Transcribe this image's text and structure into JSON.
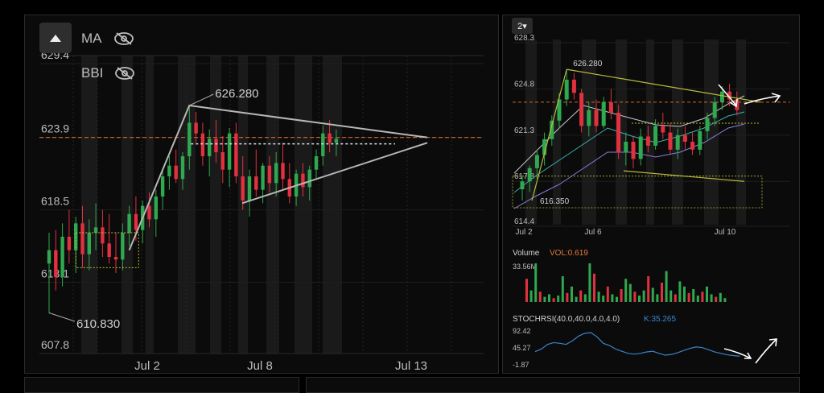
{
  "main": {
    "indicators": [
      {
        "label": "MA",
        "icon": "eye-off-icon"
      },
      {
        "label": "BBI",
        "icon": "eye-off-icon"
      }
    ],
    "y_ticks": [
      "629.4",
      "623.9",
      "618.5",
      "613.1",
      "607.8"
    ],
    "x_ticks": [
      "Jul 2",
      "Jul 8",
      "Jul 13"
    ],
    "high_label": "626.280",
    "low_label": "610.830"
  },
  "side": {
    "interval_select": "2▾",
    "y_ticks": [
      "628.3",
      "624.8",
      "621.3",
      "617.8",
      "614.4"
    ],
    "x_ticks": [
      "Jul 2",
      "Jul 6",
      "Jul 10"
    ],
    "high_label": "626.280",
    "low_label": "616.350",
    "volume": {
      "label": "Volume",
      "indicator": "VOL:0.619",
      "max": "33.56M"
    },
    "stoch": {
      "label": "STOCHRSI(40.0,40.0,4.0,4.0)",
      "k": "K:35.265",
      "ticks": [
        "92.42",
        "45.27",
        "-1.87"
      ]
    }
  },
  "colors": {
    "up": "#2fa84f",
    "down": "#e0313f",
    "pattern": "#b7b7b7",
    "guide": "#d9672e",
    "stoch": "#3a83c9",
    "fib": "#b8bd3a"
  },
  "chart_data": [
    {
      "type": "candlestick",
      "ylim": [
        607.8,
        629.4
      ],
      "x_ticks": [
        "Jul 2",
        "Jul 8",
        "Jul 13"
      ],
      "y_ticks": [
        629.4,
        623.9,
        618.5,
        613.1,
        607.8
      ],
      "grid": true,
      "annotations": [
        {
          "text": "626.280",
          "value": 626.28
        },
        {
          "text": "610.830",
          "value": 610.83
        }
      ],
      "reference_line": 623.9,
      "candles": [
        [
          614.5,
          616.8,
          610.8,
          615.5
        ],
        [
          615.5,
          617.0,
          612.5,
          613.5
        ],
        [
          613.5,
          617.5,
          612.8,
          616.5
        ],
        [
          616.5,
          618.5,
          614.5,
          615.5
        ],
        [
          615.5,
          618.0,
          613.8,
          617.5
        ],
        [
          617.5,
          618.8,
          614.2,
          615.2
        ],
        [
          615.2,
          617.8,
          614.0,
          616.8
        ],
        [
          616.8,
          619.0,
          615.5,
          617.2
        ],
        [
          617.2,
          618.5,
          615.0,
          616.0
        ],
        [
          616.0,
          618.2,
          614.5,
          615.0
        ],
        [
          615.0,
          616.8,
          613.8,
          614.8
        ],
        [
          614.8,
          617.5,
          614.0,
          616.8
        ],
        [
          616.8,
          618.8,
          615.8,
          618.2
        ],
        [
          618.2,
          619.5,
          616.2,
          617.0
        ],
        [
          617.0,
          619.2,
          616.0,
          618.8
        ],
        [
          618.8,
          619.8,
          617.2,
          617.8
        ],
        [
          617.8,
          620.0,
          616.5,
          619.5
        ],
        [
          619.5,
          621.5,
          618.5,
          621.0
        ],
        [
          621.0,
          622.5,
          620.0,
          621.8
        ],
        [
          621.8,
          623.0,
          620.5,
          620.8
        ],
        [
          620.8,
          622.8,
          620.0,
          622.5
        ],
        [
          622.5,
          626.28,
          621.5,
          625.0
        ],
        [
          625.0,
          625.8,
          623.5,
          624.2
        ],
        [
          624.2,
          625.0,
          621.8,
          622.5
        ],
        [
          622.5,
          624.5,
          621.0,
          623.8
        ],
        [
          623.8,
          625.2,
          622.0,
          622.8
        ],
        [
          622.8,
          624.0,
          620.5,
          621.5
        ],
        [
          621.5,
          624.6,
          620.2,
          624.2
        ],
        [
          624.2,
          625.0,
          620.5,
          621.0
        ],
        [
          621.0,
          622.5,
          618.5,
          619.2
        ],
        [
          619.2,
          621.5,
          618.0,
          621.0
        ],
        [
          621.0,
          623.0,
          619.5,
          620.0
        ],
        [
          620.0,
          622.0,
          619.0,
          621.8
        ],
        [
          621.8,
          622.5,
          619.8,
          620.5
        ],
        [
          620.5,
          622.8,
          619.5,
          622.0
        ],
        [
          622.0,
          623.5,
          620.0,
          620.8
        ],
        [
          620.8,
          622.0,
          619.0,
          619.5
        ],
        [
          619.5,
          621.5,
          618.8,
          621.2
        ],
        [
          621.2,
          622.0,
          619.5,
          620.2
        ],
        [
          620.2,
          621.8,
          619.2,
          621.5
        ],
        [
          621.5,
          623.0,
          620.8,
          622.5
        ],
        [
          622.5,
          624.8,
          621.8,
          624.2
        ],
        [
          624.2,
          625.2,
          622.8,
          623.5
        ],
        [
          623.5,
          624.5,
          622.5,
          623.8
        ]
      ]
    },
    {
      "type": "candlestick",
      "ylim": [
        614.4,
        628.3
      ],
      "x_ticks": [
        "Jul 2",
        "Jul 6",
        "Jul 10"
      ],
      "y_ticks": [
        628.3,
        624.8,
        621.3,
        617.8,
        614.4
      ],
      "annotations": [
        {
          "text": "626.280",
          "value": 626.28
        },
        {
          "text": "616.350",
          "value": 616.35
        }
      ],
      "candles": [
        [
          617.2,
          618.2,
          616.35,
          617.8
        ],
        [
          617.8,
          619.0,
          617.0,
          618.8
        ],
        [
          618.8,
          620.2,
          618.0,
          619.8
        ],
        [
          619.8,
          621.5,
          619.0,
          621.0
        ],
        [
          621.0,
          622.8,
          620.5,
          622.4
        ],
        [
          622.4,
          624.5,
          621.8,
          624.0
        ],
        [
          624.0,
          626.28,
          623.5,
          625.5
        ],
        [
          625.5,
          626.0,
          624.0,
          624.5
        ],
        [
          624.5,
          624.8,
          621.5,
          622.0
        ],
        [
          622.0,
          623.8,
          621.2,
          623.2
        ],
        [
          623.2,
          624.0,
          621.5,
          622.0
        ],
        [
          622.0,
          624.2,
          621.8,
          623.8
        ],
        [
          623.8,
          624.8,
          622.5,
          623.0
        ],
        [
          623.0,
          623.6,
          619.5,
          620.0
        ],
        [
          620.0,
          621.5,
          619.0,
          620.8
        ],
        [
          620.8,
          621.2,
          618.8,
          619.5
        ],
        [
          619.5,
          621.8,
          619.0,
          621.2
        ],
        [
          621.2,
          622.0,
          620.0,
          620.5
        ],
        [
          620.5,
          622.5,
          620.2,
          622.0
        ],
        [
          622.0,
          623.0,
          621.0,
          621.5
        ],
        [
          621.5,
          622.2,
          619.8,
          620.2
        ],
        [
          620.2,
          621.8,
          619.5,
          621.3
        ],
        [
          621.3,
          622.0,
          620.2,
          620.8
        ],
        [
          620.8,
          621.5,
          619.8,
          620.2
        ],
        [
          620.2,
          622.0,
          619.8,
          621.6
        ],
        [
          621.6,
          623.0,
          621.0,
          622.6
        ],
        [
          622.6,
          624.2,
          622.0,
          623.8
        ],
        [
          623.8,
          625.0,
          623.2,
          624.6
        ],
        [
          624.6,
          625.2,
          623.5,
          624.0
        ],
        [
          624.0,
          624.6,
          622.8,
          623.2
        ]
      ]
    },
    {
      "type": "bar",
      "title": "Volume",
      "y_max_label": "33.56M",
      "values": [
        18,
        9,
        30,
        8,
        4,
        6,
        3,
        5,
        20,
        7,
        12,
        4,
        9,
        6,
        30,
        22,
        8,
        5,
        12,
        6,
        4,
        10,
        18,
        14,
        8,
        5,
        9,
        20,
        11,
        6,
        15,
        24,
        9,
        6,
        16,
        12,
        7,
        10,
        5,
        8,
        12,
        6,
        4,
        7,
        3
      ]
    },
    {
      "type": "line",
      "title": "STOCHRSI(40.0,40.0,4.0,4.0)",
      "ylim": [
        -1.87,
        92.42
      ],
      "y_ticks": [
        92.42,
        45.27,
        -1.87
      ],
      "k_value": 35.265,
      "series": [
        {
          "name": "K",
          "values": [
            35,
            42,
            55,
            60,
            58,
            55,
            65,
            78,
            86,
            88,
            76,
            58,
            52,
            42,
            36,
            30,
            28,
            30,
            34,
            36,
            30,
            25,
            27,
            32,
            38,
            44,
            48,
            46,
            40,
            34,
            30,
            26,
            24,
            22
          ]
        }
      ]
    }
  ]
}
